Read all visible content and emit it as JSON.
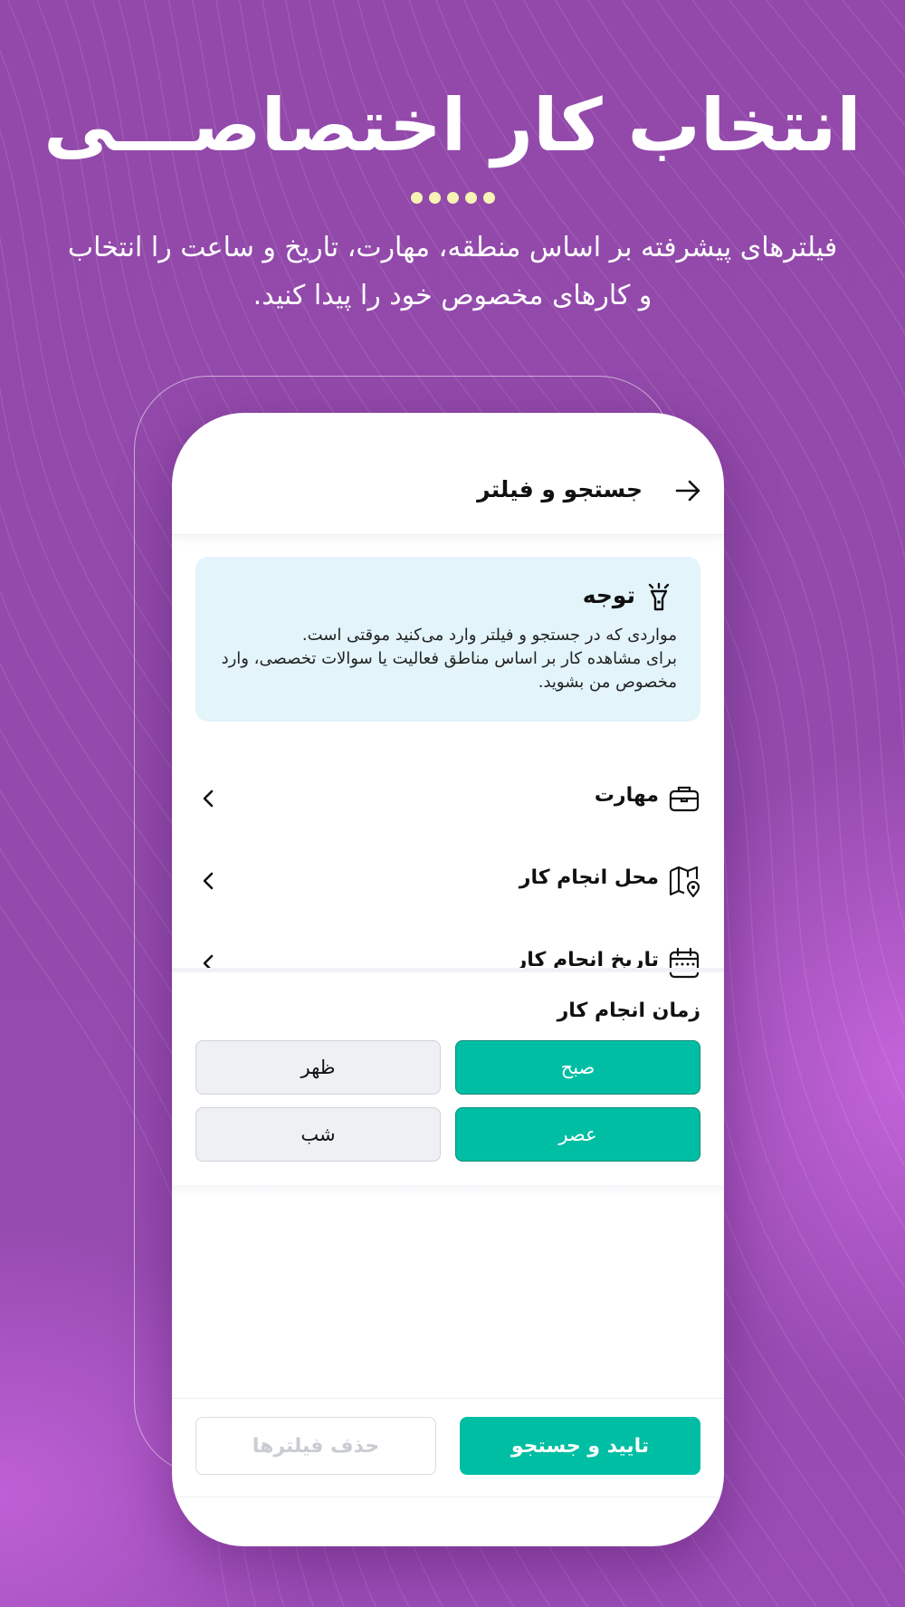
{
  "promo": {
    "headline": "انتخاب کار اختصاصـــی",
    "pagination_dots": 5,
    "subtitle": "فیلترهای پیشرفته بر اساس منطقه، مهارت، تاریخ و ساعت را انتخاب و کارهای مخصوص خود را پیدا کنید."
  },
  "app": {
    "header": {
      "title": "جستجو و فیلتر",
      "back_icon": "arrow-right-icon"
    },
    "notice": {
      "icon": "flashlight-icon",
      "title": "توجه",
      "line1": "مواردی که در جستجو و فیلتر وارد می‌کنید موقتی است.",
      "line2": "برای مشاهده کار بر اساس مناطق فعالیت یا سوالات تخصصی، وارد مخصوص من بشوید."
    },
    "filters": [
      {
        "label": "مهارت",
        "icon": "briefcase-icon"
      },
      {
        "label": "محل انجام کار",
        "icon": "map-pin-icon"
      },
      {
        "label": "تاریخ انجام کار",
        "icon": "calendar-icon"
      }
    ],
    "time_section": {
      "title": "زمان انجام کار",
      "options": [
        {
          "label": "صبح",
          "selected": true
        },
        {
          "label": "ظهر",
          "selected": false
        },
        {
          "label": "عصر",
          "selected": true
        },
        {
          "label": "شب",
          "selected": false
        }
      ]
    },
    "footer": {
      "confirm_label": "تایید و جستجو",
      "clear_label": "حذف فیلترها"
    },
    "colors": {
      "accent": "#00bea3",
      "notice_bg": "#e3f4fa",
      "background": "#934aac",
      "dots": "#f6f3b4"
    }
  }
}
